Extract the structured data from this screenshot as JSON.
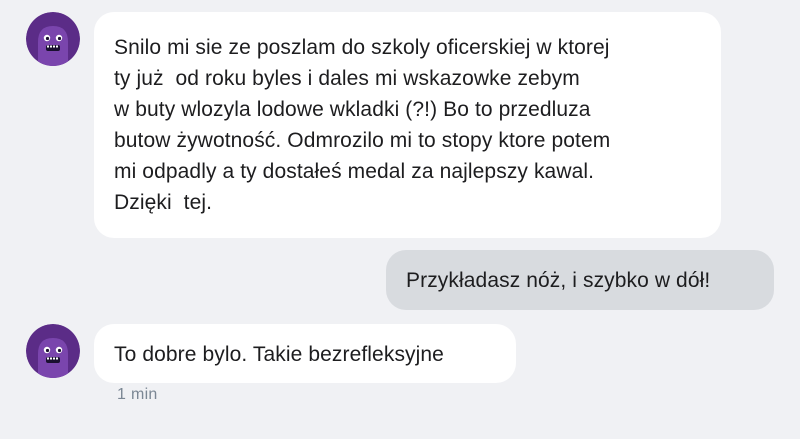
{
  "conversation": {
    "messages": [
      {
        "direction": "incoming",
        "lines": [
          "Snilo mi sie ze poszlam do szkoly oficerskiej w ktorej",
          "ty już  od roku byles i dales mi wskazowke zebym",
          "w buty wlozyla lodowe wkladki (?!) Bo to przedluza",
          "butow żywotność. Odmrozilo mi to stopy ktore potem",
          "mi odpadly a ty dostałeś medal za najlepszy kawal.",
          "Dzięki  tej."
        ]
      },
      {
        "direction": "outgoing",
        "text": "Przykładasz nóż, i szybko w dół!"
      },
      {
        "direction": "incoming",
        "text": "To dobre bylo. Takie bezrefleksyjne",
        "timestamp": "1 min"
      }
    ]
  },
  "avatar": {
    "icon": "purple-ghost-avatar-icon",
    "background_color": "#5b2c87",
    "body_color": "#7a45ad"
  },
  "colors": {
    "background": "#f0f1f4",
    "incoming_bubble": "#ffffff",
    "outgoing_bubble": "#d8dbdf",
    "text": "#1d1d1f",
    "timestamp": "#7b8794"
  }
}
